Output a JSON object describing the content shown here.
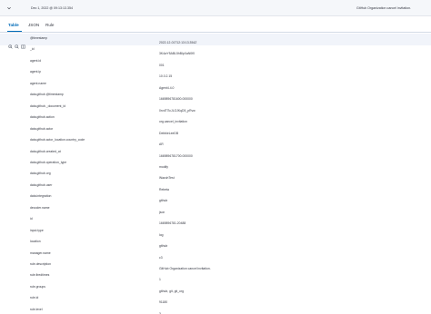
{
  "header": {
    "date": "Dec 1, 2022 @ 09:13:13.354",
    "rule_description": "GitHub Organization cancel invitation."
  },
  "tabs": [
    {
      "label": "Table",
      "active": true
    },
    {
      "label": "JSON",
      "active": false
    },
    {
      "label": "Rule",
      "active": false
    }
  ],
  "fields": [
    {
      "name": "@timestamp",
      "value": "2022-12-01T12:13:13.354Z"
    },
    {
      "name": "_id",
      "value": "3K4wY5ABL5hBlpXaN0f0"
    },
    {
      "name": "agent.id",
      "value": "001"
    },
    {
      "name": "agent.ip",
      "value": "10.0.2.15"
    },
    {
      "name": "agent.name",
      "value": "Agent4.4.0"
    },
    {
      "name": "data.github.@timestamp",
      "value": "1669896781600.000000"
    },
    {
      "name": "data.github._document_id",
      "value": "0rvdT7lcJLOJKqD5_pRvw"
    },
    {
      "name": "data.github.action",
      "value": "org.cancel_invitation"
    },
    {
      "name": "data.github.actor",
      "value": "DebbieLeeDB"
    },
    {
      "name": "data.github.actor_location.country_code",
      "value": "AR"
    },
    {
      "name": "data.github.created_at",
      "value": "1669896781700.000000"
    },
    {
      "name": "data.github.operation_type",
      "value": "modify"
    },
    {
      "name": "data.github.org",
      "value": "WazuhTest"
    },
    {
      "name": "data.github.user",
      "value": "Rebeta"
    },
    {
      "name": "data.integration",
      "value": "github"
    },
    {
      "name": "decoder.name",
      "value": "json"
    },
    {
      "name": "id",
      "value": "1669896781.20488"
    },
    {
      "name": "input.type",
      "value": "log"
    },
    {
      "name": "location",
      "value": "github"
    },
    {
      "name": "manager.name",
      "value": "c3"
    },
    {
      "name": "rule.description",
      "value": "GitHub Organization cancel invitation."
    },
    {
      "name": "rule.firedtimes",
      "value": "1"
    },
    {
      "name": "rule.groups",
      "value": "github, git, git_org"
    },
    {
      "name": "rule.id",
      "value": "91180"
    },
    {
      "name": "rule.level",
      "value": "3"
    }
  ]
}
